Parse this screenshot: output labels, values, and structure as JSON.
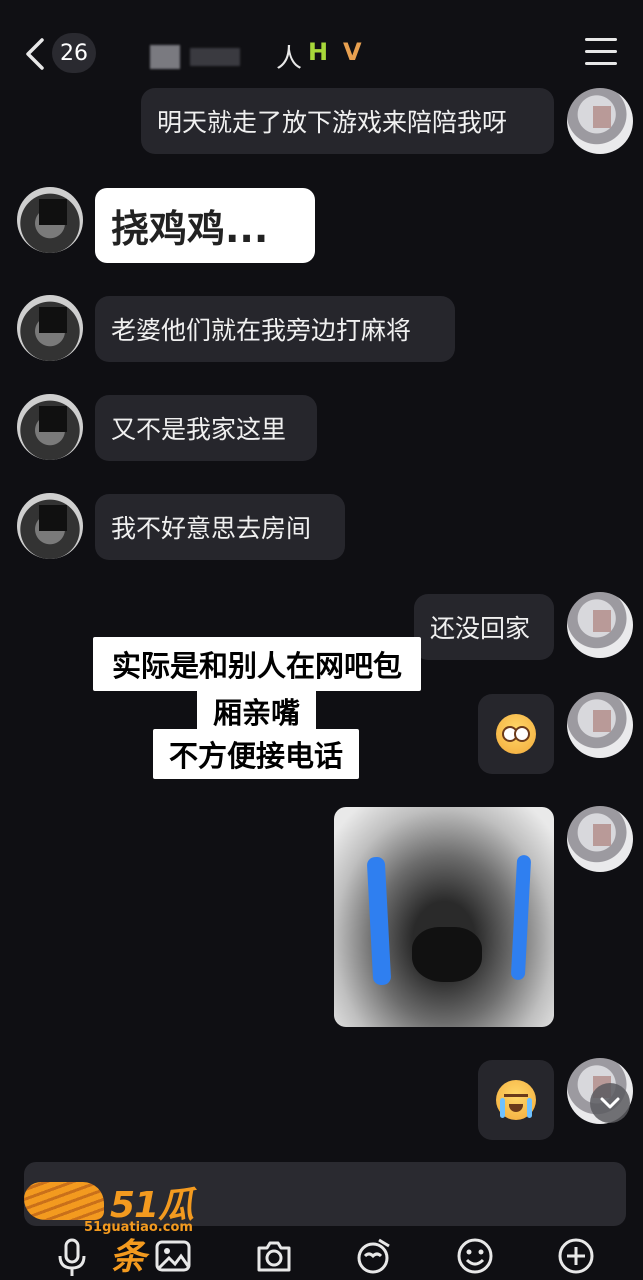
{
  "header": {
    "unread_count": "26",
    "title_char": "人",
    "emoji_h": "H",
    "emoji_v": "V"
  },
  "messages": [
    {
      "side": "right",
      "text": "明天就走了放下游戏来陪陪我呀"
    },
    {
      "side": "left",
      "text": "挠鸡鸡..."
    },
    {
      "side": "left",
      "text": "老婆他们就在我旁边打麻将"
    },
    {
      "side": "left",
      "text": "又不是我家这里"
    },
    {
      "side": "left",
      "text": "我不好意思去房间"
    },
    {
      "side": "right",
      "text": "还没回家"
    },
    {
      "side": "right",
      "emoji": "pleading-face"
    },
    {
      "side": "right",
      "image": "crying-cat-meme"
    },
    {
      "side": "right",
      "emoji": "crying-face"
    }
  ],
  "annotation": {
    "line1": "实际是和别人在网吧包",
    "line2": "厢亲嘴",
    "line3": "不方便接电话"
  },
  "watermark": {
    "brand": "51瓜条",
    "site": "51guatiao.com"
  },
  "toolbar": {
    "icons": [
      "microphone-icon",
      "image-icon",
      "camera-icon",
      "sticker-icon",
      "emoji-icon",
      "plus-icon"
    ]
  },
  "colors": {
    "background": "#0f0f13",
    "bubble": "#26262c",
    "accent": "#f39a1f",
    "tear": "#2f7ff0"
  }
}
